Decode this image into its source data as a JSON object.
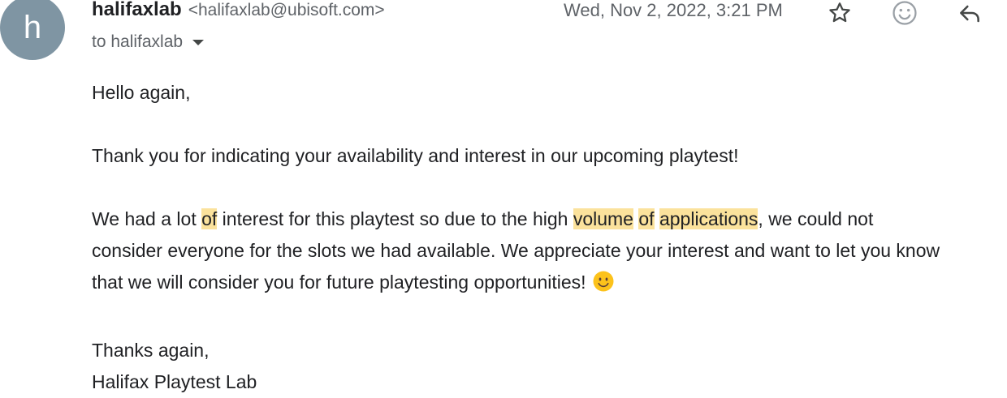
{
  "header": {
    "avatar_letter": "h",
    "sender_name": "halifaxlab",
    "sender_email": "<halifaxlab@ubisoft.com>",
    "date": "Wed, Nov 2, 2022, 3:21 PM",
    "to_label": "to halifaxlab",
    "icons": [
      "star-icon",
      "emoji-reaction-icon",
      "reply-icon",
      "dropdown-caret-icon"
    ]
  },
  "body": {
    "greeting": "Hello again,",
    "para1": "Thank you for indicating your availability and interest in our upcoming playtest!",
    "para2": {
      "seg1": "We had a lot ",
      "hl1": "of",
      "seg2": " interest for this playtest so due to the high ",
      "hl2": "volume",
      "seg3": " ",
      "hl3": "of",
      "seg4": " ",
      "hl4": "applications",
      "seg5": ", we could not",
      "line2": "consider everyone for the slots we had available. We appreciate your interest and want to let you know",
      "line3": "that we will consider you for future playtesting opportunities!"
    },
    "closing": "Thanks again,",
    "signature": "Halifax Playtest Lab"
  },
  "colors": {
    "avatar_bg": "#7f95a3",
    "highlight": "#fbe29c",
    "secondary_text": "#5f6368",
    "primary_text": "#202124"
  }
}
